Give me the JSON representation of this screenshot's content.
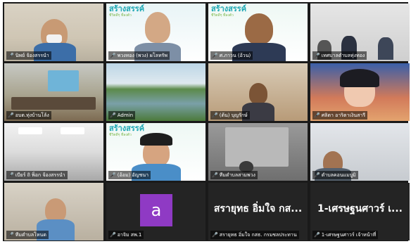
{
  "meeting": {
    "participants": [
      {
        "name": "นิพย์ จ้องสรรนำ",
        "logo": ""
      },
      {
        "name": "พวงทอง (พวง) ผโลทรัพ",
        "logo": "สร้างสรรค์"
      },
      {
        "name": "ศ.ภาวน (อ้วน)",
        "logo": "สร้างสรรค์"
      },
      {
        "name": "เทศบาลตำบลทุ่งทอง",
        "logo": ""
      },
      {
        "name": "อบต.ทุ่งบ้านโล้ง",
        "logo": ""
      },
      {
        "name": "Admin",
        "logo": ""
      },
      {
        "name": "(ต้น) บุญรักษ์",
        "logo": ""
      },
      {
        "name": "ศลิตา อาริตาเงินสารี",
        "logo": ""
      },
      {
        "name": "เบียร์ ถิ พ็อก จ้องสรรนำ",
        "logo": ""
      },
      {
        "name": "(อ้อม) อัญชนา",
        "logo": "สร้างสรรค์"
      },
      {
        "name": "ทีมตำบลสามพวง",
        "logo": ""
      },
      {
        "name": "ตำบลคอนแมบูมิ",
        "logo": ""
      },
      {
        "name": "ทีมตำบลโหนด",
        "logo": ""
      },
      {
        "name": "อาจิม สพ.1",
        "logo": ""
      },
      {
        "name": "สรายุทธ อิ่มใจ กสธ. กรมชลประทาน",
        "logo": ""
      },
      {
        "name": "1-เศรษฐนศาวร์ เจ้าหน้าที่",
        "logo": ""
      }
    ],
    "avatar_letter": "a",
    "large_text_1": "สรายุทธ อิ่มใจ กส...",
    "large_text_2": "1-เศรษฐนศาวร์ เ...",
    "logo_subtitle": "ชีวิตดีๆ ที่ลงตัว"
  },
  "colors": {
    "speaker_outline": "#7ed957",
    "mic_muted": "#e0453a",
    "avatar_bg": "#8f3ac4"
  }
}
